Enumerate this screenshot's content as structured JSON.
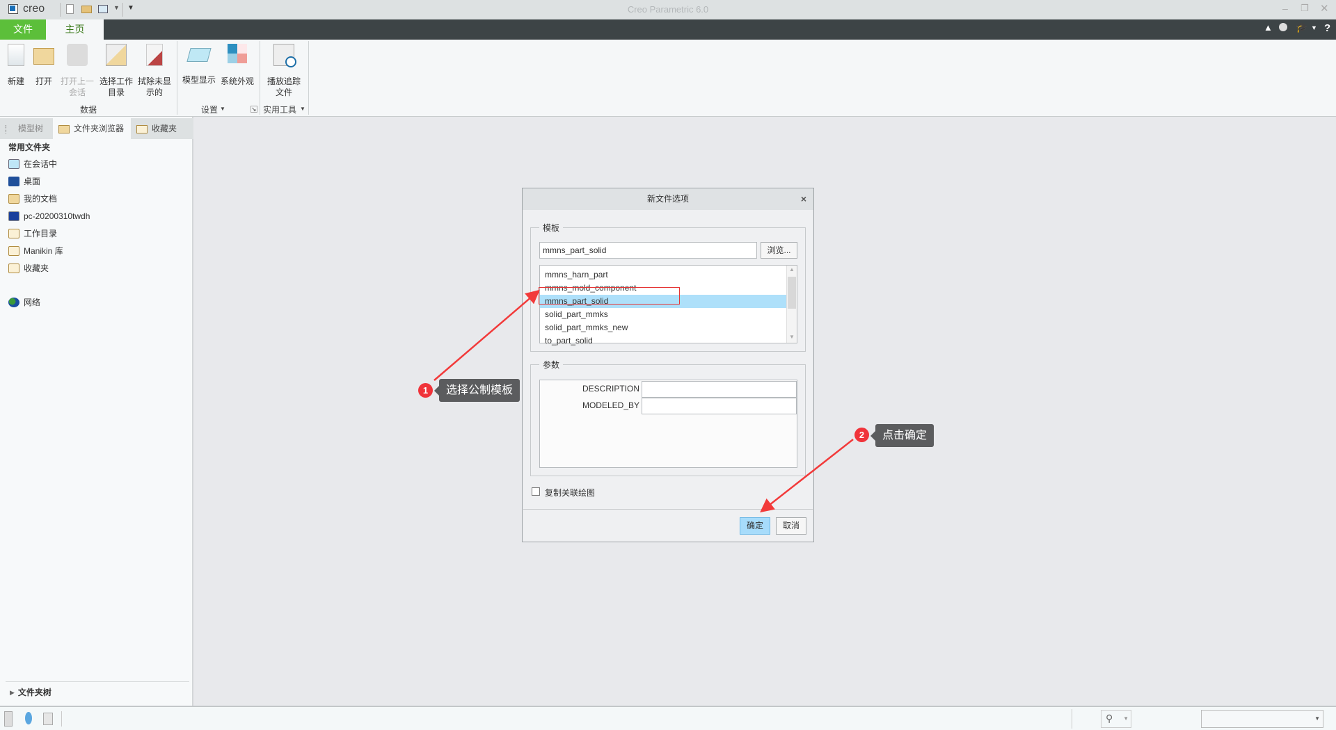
{
  "window": {
    "title": "Creo Parametric 6.0",
    "logo": "creo"
  },
  "tabs": [
    {
      "label": "文件",
      "active": false
    },
    {
      "label": "主页",
      "active": true
    }
  ],
  "ribbon": {
    "buttons": [
      {
        "label": "新建",
        "icon": "new-file-icon"
      },
      {
        "label": "打开",
        "icon": "open-folder-icon"
      },
      {
        "label": "打开上一会话",
        "line1": "打开上一",
        "line2": "会话",
        "icon": "open-last-session-icon",
        "disabled": true
      },
      {
        "label": "选择工作目录",
        "line1": "选择工作",
        "line2": "目录",
        "icon": "working-directory-icon"
      },
      {
        "label": "拭除未显示的",
        "line1": "拭除未显",
        "line2": "示的",
        "icon": "erase-icon"
      },
      {
        "label": "模型显示",
        "icon": "model-display-icon"
      },
      {
        "label": "系统外观",
        "icon": "system-appearance-icon"
      },
      {
        "label": "播放追踪文件",
        "line1": "播放追踪",
        "line2": "文件",
        "icon": "playback-trail-icon"
      }
    ],
    "groups": {
      "data": "数据",
      "settings": "设置",
      "utilities": "实用工具"
    }
  },
  "leftpanel": {
    "tabs": [
      "模型树",
      "文件夹浏览器",
      "收藏夹"
    ],
    "section": "常用文件夹",
    "items": [
      "在会话中",
      "桌面",
      "我的文档",
      "pc-20200310twdh",
      "工作目录",
      "Manikin 库",
      "收藏夹"
    ],
    "network": "网络",
    "folder_tree": "文件夹树"
  },
  "dialog": {
    "title": "新文件选项",
    "template_group": "模板",
    "template_value": "mmns_part_solid",
    "browse": "浏览...",
    "templates": [
      "mmns_harn_part",
      "mmns_mold_component",
      "mmns_part_solid",
      "solid_part_mmks",
      "solid_part_mmks_new",
      "to_part_solid"
    ],
    "selected_index": 2,
    "params_group": "参数",
    "params": [
      {
        "name": "DESCRIPTION",
        "value": ""
      },
      {
        "name": "MODELED_BY",
        "value": ""
      }
    ],
    "copy_drawing": "复制关联绘图",
    "copy_drawing_checked": false,
    "ok": "确定",
    "cancel": "取消"
  },
  "annotations": [
    {
      "number": "1",
      "text": "选择公制模板"
    },
    {
      "number": "2",
      "text": "点击确定"
    }
  ],
  "colors": {
    "accent_green": "#5cbf3a",
    "tabbar": "#3d4446",
    "selection": "#aee0fa",
    "annotation_red": "#f0333a"
  }
}
